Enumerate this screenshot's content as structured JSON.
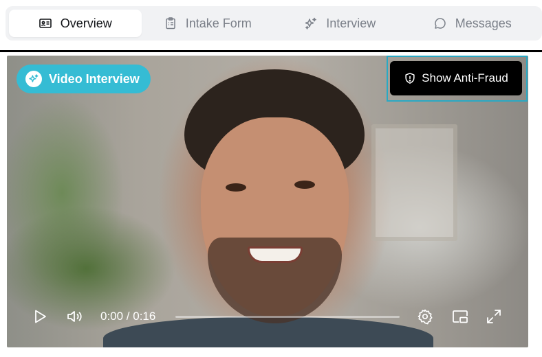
{
  "tabs": [
    {
      "label": "Overview",
      "icon": "id-card-icon",
      "active": true
    },
    {
      "label": "Intake Form",
      "icon": "clipboard-list-icon",
      "active": false
    },
    {
      "label": "Interview",
      "icon": "sparkles-icon",
      "active": false
    },
    {
      "label": "Messages",
      "icon": "chat-bubble-icon",
      "active": false
    }
  ],
  "video": {
    "badge_label": "Video Interview",
    "badge_icon": "sparkles-icon",
    "anti_fraud_label": "Show Anti-Fraud",
    "anti_fraud_icon": "shield-alert-icon",
    "time_display": "0:00 / 0:16",
    "progress": 0
  },
  "colors": {
    "accent": "#35bcd4",
    "outline": "#2aa9c4",
    "tab_bar_bg": "#f1f2f4"
  }
}
